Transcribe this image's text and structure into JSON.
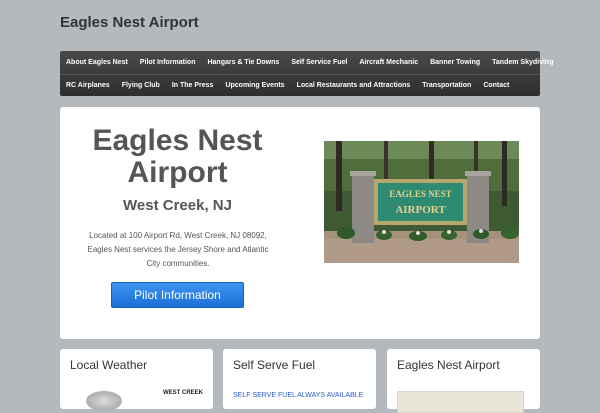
{
  "site": {
    "title": "Eagles Nest Airport"
  },
  "nav": {
    "row1": [
      "About Eagles Nest",
      "Pilot Information",
      "Hangars & Tie Downs",
      "Self Service Fuel",
      "Aircraft Mechanic",
      "Banner Towing",
      "Tandem Skydiving"
    ],
    "row2": [
      "RC Airplanes",
      "Flying Club",
      "In The Press",
      "Upcoming Events",
      "Local Restaurants and Attractions",
      "Transportation",
      "Contact"
    ]
  },
  "hero": {
    "title_line1": "Eagles Nest",
    "title_line2": "Airport",
    "subtitle": "West Creek, NJ",
    "description": "Located at 100 Airport Rd, West Creek, NJ 08092, Eagles Nest services the Jersey Shore and Atlantic City communities.",
    "button_label": "Pilot Information",
    "sign_line1": "EAGLES NEST",
    "sign_line2": "AIRPORT"
  },
  "cards": {
    "weather": {
      "title": "Local Weather",
      "location": "WEST CREEK"
    },
    "fuel": {
      "title": "Self Serve Fuel",
      "text": "SELF SERVE FUEL ALWAYS AVAILABLE"
    },
    "airport": {
      "title": "Eagles Nest Airport"
    }
  }
}
